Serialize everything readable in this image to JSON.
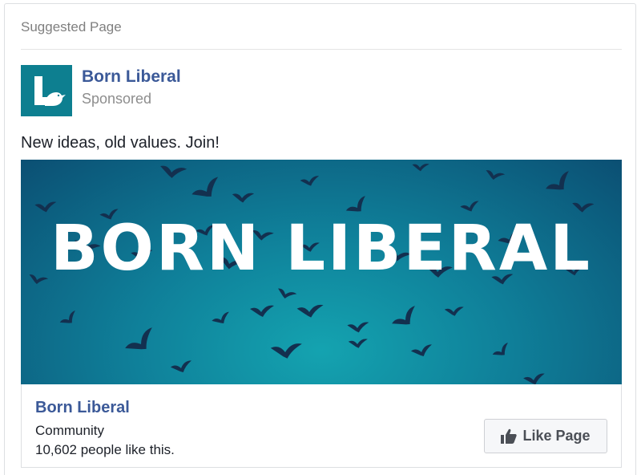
{
  "card": {
    "header": "Suggested Page"
  },
  "post": {
    "page_name": "Born Liberal",
    "sponsored_label": "Sponsored",
    "text": "New ideas, old values. Join!",
    "avatar_icon": "born-liberal-logo-icon"
  },
  "banner": {
    "title": "BORN LIBERAL",
    "background_color": "#0f7f99",
    "bird_color": "#13304f"
  },
  "footer": {
    "page_name": "Born Liberal",
    "category": "Community",
    "likes": "10,602 people like this.",
    "like_button_label": "Like Page",
    "like_icon": "thumbs-up-icon"
  },
  "colors": {
    "link": "#3b5998",
    "muted": "#8d8d8d"
  }
}
